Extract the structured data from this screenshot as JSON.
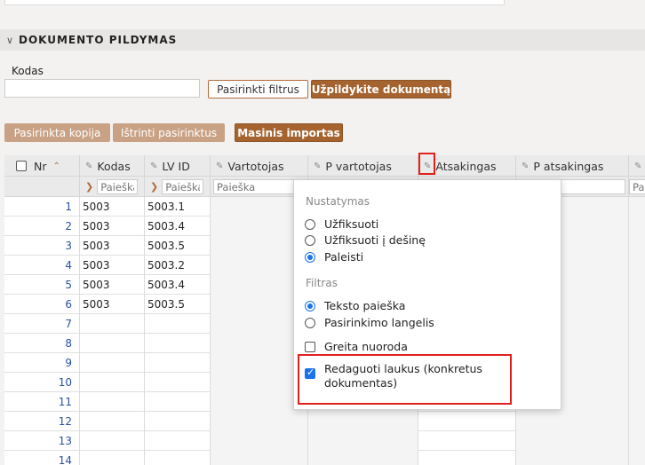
{
  "section": {
    "title": "DOKUMENTO PILDYMAS",
    "chevron_icon": "chevron-down-icon"
  },
  "kodas": {
    "label": "Kodas",
    "value": ""
  },
  "buttons": {
    "choose_filters": "Pasirinkti filtrus",
    "fill_document": "Užpildykite dokumentą",
    "selected_copy": "Pasirinkta kopija",
    "delete_selected": "Ištrinti pasirinktus",
    "mass_import": "Masinis importas"
  },
  "grid": {
    "headers": {
      "nr": "Nr",
      "kodas": "Kodas",
      "lvid": "LV ID",
      "vartotojas": "Vartotojas",
      "pvartotojas": "P vartotojas",
      "atsakingas": "Atsakingas",
      "patsakingas": "P atsakingas",
      "extra": ""
    },
    "filter_placeholder": "Paieška",
    "rows": [
      {
        "nr": "1",
        "kodas": "5003",
        "lvid": "5003.1"
      },
      {
        "nr": "2",
        "kodas": "5003",
        "lvid": "5003.4"
      },
      {
        "nr": "3",
        "kodas": "5003",
        "lvid": "5003.5"
      },
      {
        "nr": "4",
        "kodas": "5003",
        "lvid": "5003.2"
      },
      {
        "nr": "5",
        "kodas": "5003",
        "lvid": "5003.4"
      },
      {
        "nr": "6",
        "kodas": "5003",
        "lvid": "5003.5"
      },
      {
        "nr": "7",
        "kodas": "",
        "lvid": ""
      },
      {
        "nr": "8",
        "kodas": "",
        "lvid": ""
      },
      {
        "nr": "9",
        "kodas": "",
        "lvid": ""
      },
      {
        "nr": "10",
        "kodas": "",
        "lvid": ""
      },
      {
        "nr": "11",
        "kodas": "",
        "lvid": ""
      },
      {
        "nr": "12",
        "kodas": "",
        "lvid": ""
      },
      {
        "nr": "13",
        "kodas": "",
        "lvid": ""
      },
      {
        "nr": "14",
        "kodas": "",
        "lvid": ""
      }
    ]
  },
  "popup": {
    "section_setting": "Nustatymas",
    "opt_fix": "Užfiksuoti",
    "opt_fix_right": "Užfiksuoti į dešinę",
    "opt_release": "Paleisti",
    "section_filter": "Filtras",
    "opt_text_search": "Teksto paieška",
    "opt_checkbox": "Pasirinkimo langelis",
    "opt_quick_link": "Greita nuoroda",
    "opt_edit_fields_1": "Redaguoti laukus (konkretus",
    "opt_edit_fields_2": "dokumentas)"
  },
  "colors": {
    "accent": "#a5632f",
    "light_accent": "#c9a184",
    "highlight": "#e0201b",
    "radio_blue": "#1a73e8",
    "link_blue": "#2b4f9e"
  }
}
